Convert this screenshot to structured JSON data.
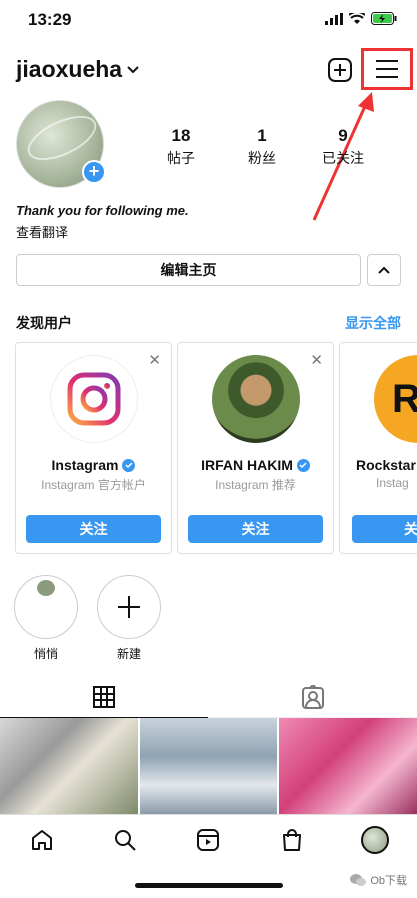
{
  "status_bar": {
    "time": "13:29"
  },
  "header": {
    "username": "jiaoxueha"
  },
  "profile": {
    "stats": [
      {
        "value": "18",
        "label": "帖子"
      },
      {
        "value": "1",
        "label": "粉丝"
      },
      {
        "value": "9",
        "label": "已关注"
      }
    ],
    "bio": "Thank you for following me.",
    "translate": "查看翻译",
    "edit_button": "编辑主页"
  },
  "discover": {
    "title": "发现用户",
    "show_all": "显示全部",
    "cards": [
      {
        "name": "Instagram",
        "subtitle": "Instagram 官方帐户",
        "follow": "关注"
      },
      {
        "name": "IRFAN HAKIM",
        "subtitle": "Instagram 推荐",
        "follow": "关注"
      },
      {
        "name": "Rockstar",
        "subtitle": "Instag",
        "follow": "关"
      }
    ]
  },
  "highlights": [
    {
      "label": "悄悄"
    },
    {
      "label": "新建"
    }
  ],
  "watermark": "Ob下载",
  "colors": {
    "accent": "#3897f0",
    "annotation": "#e33333"
  }
}
